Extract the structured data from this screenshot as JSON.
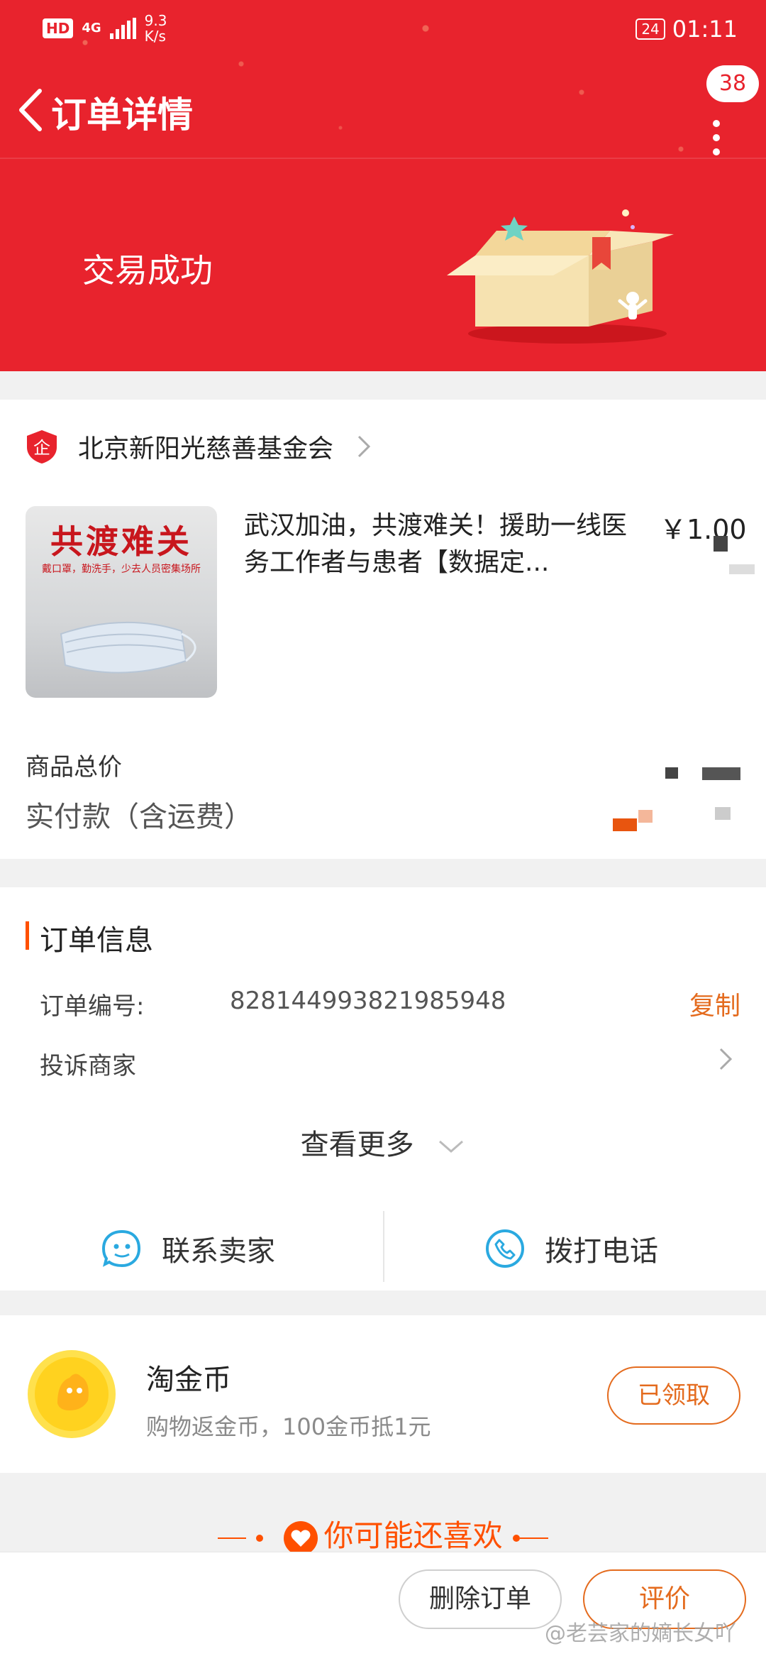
{
  "status_bar": {
    "hd": "HD",
    "network": "4G",
    "speed_value": "9.3",
    "speed_unit": "K/s",
    "battery": "24",
    "time": "01:11"
  },
  "nav": {
    "title": "订单详情",
    "message_count": "38"
  },
  "banner": {
    "status": "交易成功"
  },
  "shop": {
    "name": "北京新阳光慈善基金会",
    "badge_glyph": "企"
  },
  "product": {
    "image_title": "共渡难关",
    "image_subtitle": "戴口罩，勤洗手，少去人员密集场所",
    "title": "武汉加油，共渡难关！援助一线医务工作者与患者【数据定...",
    "price": "￥1.00"
  },
  "summary": {
    "goods_total_label": "商品总价",
    "paid_label": "实付款（含运费）"
  },
  "order_info": {
    "section_title": "订单信息",
    "order_no_label": "订单编号:",
    "order_no_value": "828144993821985948",
    "copy_label": "复制",
    "complain_label": "投诉商家",
    "see_more_label": "查看更多"
  },
  "actions": {
    "contact_seller": "联系卖家",
    "call_phone": "拨打电话"
  },
  "coins": {
    "title": "淘金币",
    "subtitle": "购物返金币，100金币抵1元",
    "button": "已领取"
  },
  "recommend": {
    "title": "你可能还喜欢"
  },
  "bottom": {
    "delete_order": "删除订单",
    "review": "评价"
  },
  "watermark": "@老芸家的嫡长女吖",
  "colors": {
    "header_red": "#e8232d",
    "accent_orange": "#e46b1e",
    "taobao_orange": "#ff5000",
    "action_icon_blue": "#2aa9e0"
  }
}
